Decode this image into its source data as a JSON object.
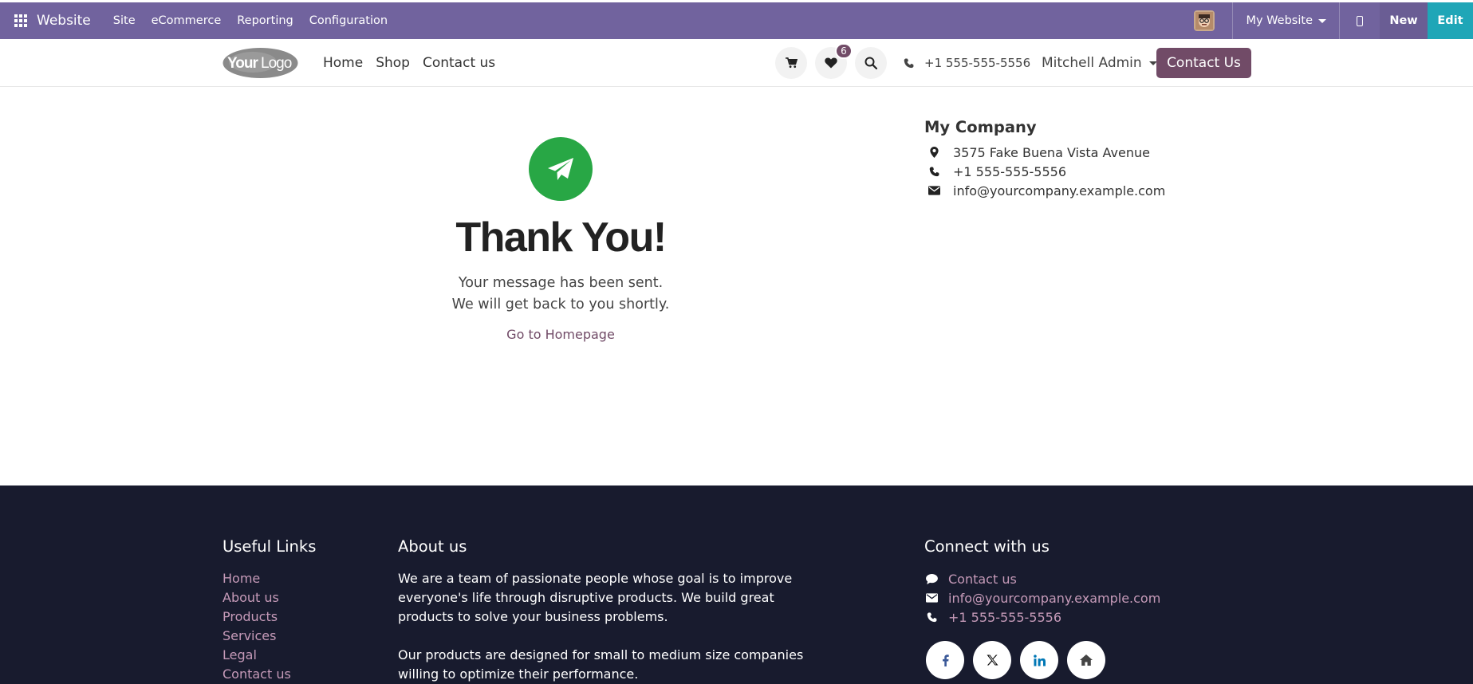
{
  "admin_bar": {
    "app_title": "Website",
    "menu": [
      "Site",
      "eCommerce",
      "Reporting",
      "Configuration"
    ],
    "website_selector": "My Website",
    "new_label": "New",
    "edit_label": "Edit"
  },
  "header": {
    "logo_text": "YourLogo",
    "nav": [
      "Home",
      "Shop",
      "Contact us"
    ],
    "wishlist_count": "6",
    "phone": "+1 555-555-5556",
    "user": "Mitchell Admin",
    "contact_button": "Contact Us"
  },
  "main": {
    "title": "Thank You!",
    "message_line1": "Your message has been sent.",
    "message_line2": "We will get back to you shortly.",
    "go_home": "Go to Homepage"
  },
  "company": {
    "name": "My Company",
    "address": "3575 Fake Buena Vista Avenue",
    "phone": "+1 555-555-5556",
    "email": "info@yourcompany.example.com"
  },
  "footer": {
    "useful_links_title": "Useful Links",
    "useful_links": [
      "Home",
      "About us",
      "Products",
      "Services",
      "Legal",
      "Contact us"
    ],
    "about_title": "About us",
    "about_p1": "We are a team of passionate people whose goal is to improve everyone's life through disruptive products. We build great products to solve your business problems.",
    "about_p2": "Our products are designed for small to medium size companies willing to optimize their performance.",
    "connect_title": "Connect with us",
    "connect_contact": "Contact us",
    "connect_email": "info@yourcompany.example.com",
    "connect_phone": "+1 555-555-5556",
    "socials": [
      "facebook-icon",
      "x-icon",
      "linkedin-icon",
      "home-icon"
    ]
  },
  "colors": {
    "admin_bar": "#71639e",
    "brand": "#714b67",
    "success": "#28a745",
    "edit": "#1fa6b7",
    "footer_bg": "#181b2e"
  }
}
